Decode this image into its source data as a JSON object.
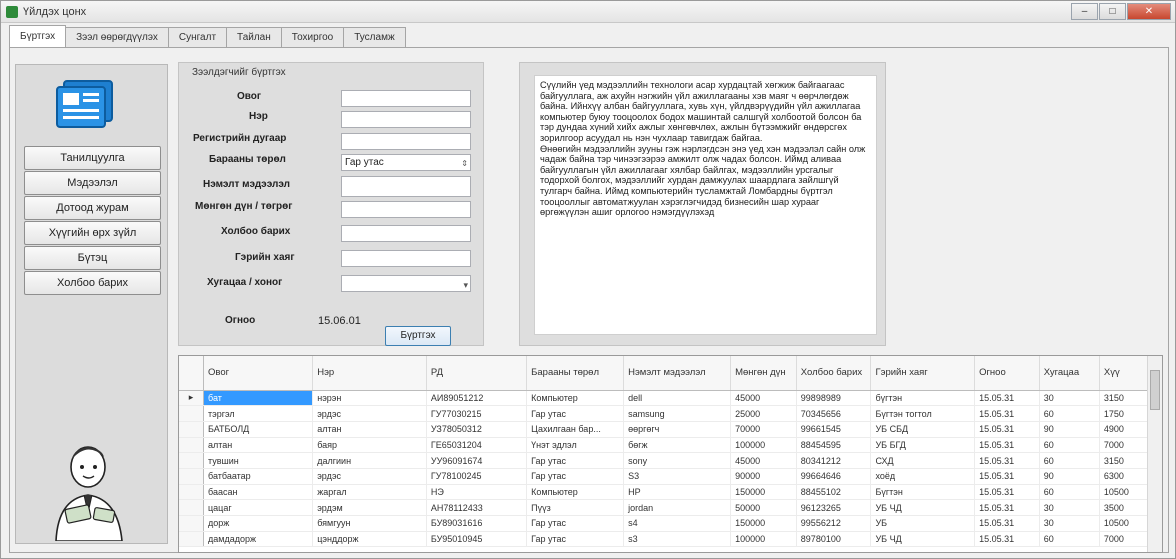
{
  "window": {
    "title": "Үйлдэх цонх"
  },
  "tabs": [
    "Бүртгэх",
    "Зээл өөрөгдүүлэх",
    "Сунгалт",
    "Тайлан",
    "Тохиргоо",
    "Тусламж"
  ],
  "sidebar": {
    "buttons": [
      "Танилцуулга",
      "Мэдээлэл",
      "Дотоод журам",
      "Хүүгийн өрх зүйл",
      "Бүтэц",
      "Холбоо барих"
    ]
  },
  "form": {
    "group_title": "Зээлдэгчийг бүртгэх",
    "labels": [
      "Овог",
      "Нэр",
      "Регистрийн дугаар",
      "Барааны төрөл",
      "Нэмэлт мэдээлэл",
      "Мөнгөн дүн / төгрөг",
      "Холбоо барих",
      "Гэрийн хаяг",
      "Хугацаа / хоног",
      "Огноо"
    ],
    "product_type_value": "Гар утас",
    "date_value": "15.06.01",
    "register_button": "Бүртгэх"
  },
  "info": {
    "paragraphs": [
      "Сүүлийн үед мэдээллийн технологи асар хурдацтай хөгжиж байгаагаас байгууллага, аж ахуйн нэгжийн үйл ажиллагааны хэв маяг ч өөрчлөгдөж байна. Ийнхүү албан байгууллага, хувь хүн, үйлдвэрүүдийн үйл ажиллагаа компьютер буюу тооцоолох бодох машинтай салшгүй холбоотой болсон ба тэр дундаа хүний хийх ажлыг хөнгөвчлөх, ажлын бүтээмжийг өндөрсгөх зорилгоор асуудал нь нэн чухлаар тавигдаж байгаа.",
      "Өнөөгийн мэдээллийн зууны гэж нэрлэгдсэн энэ үед хэн мэдээлэл сайн олж чадаж байна тэр чинээгээрээ амжилт олж чадах болсон. Иймд аливаа байгууллагын үйл ажиллагааг хялбар байлгах, мэдээллийн урсгалыг тодорхой болгох, мэдээллийг хурдан дамжуулах шаардлага зайлшгүй тулгарч байна. Иймд компьютерийн тусламжтай Ломбардны бүртгэл тооцооллыг автоматжуулан хэрэглэгчидэд бизнесийн шар хурааг өргөжүүлэн ашиг орлогоо нэмэгдүүлэхэд"
    ]
  },
  "grid": {
    "headers": [
      "Овог",
      "Нэр",
      "РД",
      "Барааны төрөл",
      "Нэмэлт мэдээлэл",
      "Мөнгөн дүн",
      "Холбоо барих",
      "Гэрийн хаяг",
      "Огноо",
      "Хугацаа",
      "Хүү"
    ],
    "rows": [
      [
        "бат",
        "нэрэн",
        "АИ89051212",
        "Компьютер",
        "dell",
        "45000",
        "99898989",
        "бүгтэн",
        "15.05.31",
        "30",
        "3150"
      ],
      [
        "тэргэл",
        "эрдэс",
        "ГУ77030215",
        "Гар утас",
        "samsung",
        "25000",
        "70345656",
        "Бүгтэн тогтол",
        "15.05.31",
        "60",
        "1750"
      ],
      [
        "БАТБОЛД",
        "алтан",
        "УЗ78050312",
        "Цахилгаан бар...",
        "өөргөгч",
        "70000",
        "99661545",
        "УБ СБД",
        "15.05.31",
        "90",
        "4900"
      ],
      [
        "алтан",
        "баяр",
        "ГЕ65031204",
        "Үнэт эдлэл",
        "бөгж",
        "100000",
        "88454595",
        "УБ БГД",
        "15.05.31",
        "60",
        "7000"
      ],
      [
        "тувшин",
        "далгиин",
        "УУ96091674",
        "Гар утас",
        "sony",
        "45000",
        "80341212",
        "СХД",
        "15.05.31",
        "60",
        "3150"
      ],
      [
        "батбаатар",
        "эрдэс",
        "ГУ78100245",
        "Гар утас",
        "S3",
        "90000",
        "99664646",
        "хоёд",
        "15.05.31",
        "90",
        "6300"
      ],
      [
        "баасан",
        "жаргал",
        "НЭ",
        "Компьютер",
        "HP",
        "150000",
        "88455102",
        "Бүгтэн",
        "15.05.31",
        "60",
        "10500"
      ],
      [
        "цацаг",
        "эрдэм",
        "АН78112433",
        "Пүүз",
        "jordan",
        "50000",
        "96123265",
        "УБ ЧД",
        "15.05.31",
        "30",
        "3500"
      ],
      [
        "дорж",
        "бямгуун",
        "БУ89031616",
        "Гар утас",
        "s4",
        "150000",
        "99556212",
        "УБ",
        "15.05.31",
        "30",
        "10500"
      ],
      [
        "дамдадорж",
        "цэнддорж",
        "БУ95010945",
        "Гар утас",
        "s3",
        "100000",
        "89780100",
        "УБ ЧД",
        "15.05.31",
        "60",
        "7000"
      ]
    ]
  }
}
